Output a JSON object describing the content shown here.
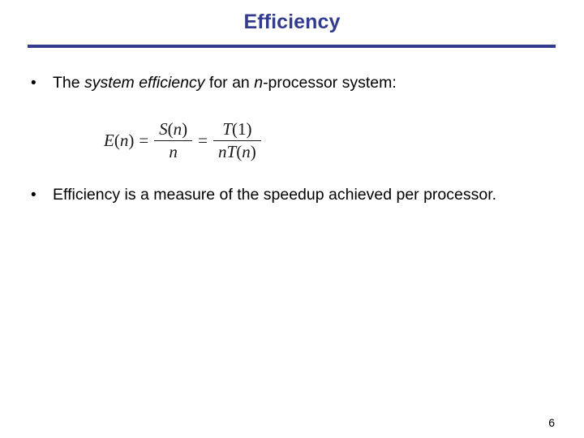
{
  "slide": {
    "title": "Efficiency",
    "title_color": "#333c8c",
    "rule_color": "#333c8c",
    "background_color": "#ffffff",
    "page_number": "6"
  },
  "bullets": [
    {
      "marker": "•",
      "segments": [
        {
          "text": "The ",
          "italic": false
        },
        {
          "text": "system efficiency",
          "italic": true
        },
        {
          "text": " for an ",
          "italic": false
        },
        {
          "text": "n",
          "italic": true
        },
        {
          "text": "-processor system:",
          "italic": false
        }
      ],
      "plain_text": "The system efficiency for an n-processor system:"
    },
    {
      "marker": "•",
      "segments": [
        {
          "text": "Efficiency is a measure of the speedup achieved per processor.",
          "italic": false
        }
      ],
      "plain_text": "Efficiency is a measure of the speedup achieved per processor."
    }
  ],
  "formula": {
    "plain_text": "E(n) = S(n)/n = T(1)/(nT(n))",
    "lhs": {
      "var": "E",
      "open": "(",
      "arg": "n",
      "close": ")"
    },
    "equals_1": "=",
    "fraction_1": {
      "numerator": {
        "var": "S",
        "open": "(",
        "arg": "n",
        "close": ")"
      },
      "denominator": {
        "var": "n"
      }
    },
    "equals_2": "=",
    "fraction_2": {
      "numerator": {
        "var": "T",
        "open": "(",
        "arg": "1",
        "close": ")"
      },
      "denominator": {
        "coef": "n",
        "var": "T",
        "open": "(",
        "arg": "n",
        "close": ")"
      }
    }
  }
}
